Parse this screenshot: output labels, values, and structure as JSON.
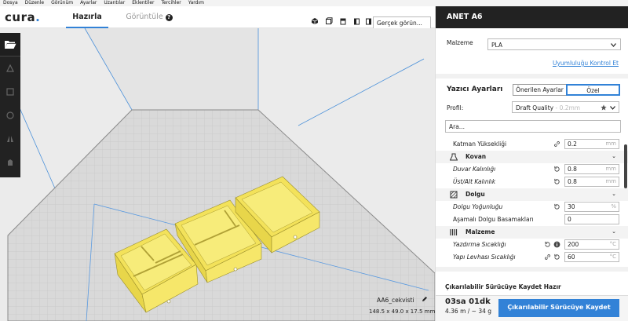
{
  "menu": [
    "Dosya",
    "Düzenle",
    "Görünüm",
    "Ayarlar",
    "Uzantılar",
    "Eklentiler",
    "Tercihler",
    "Yardım"
  ],
  "header": {
    "logo_text": "cura",
    "logo_dot": ".",
    "tab_prepare": "Hazırla",
    "tab_preview": "Görüntüle",
    "help_glyph": "?",
    "view_mode": "Gerçek görün..."
  },
  "viewport": {
    "object_name": "AA6_cekvisti",
    "object_dims": "148.5 x 49.0 x 17.5 mm"
  },
  "sidebar": {
    "printer": "ANET A6",
    "material_label": "Malzeme",
    "material_value": "PLA",
    "compat_link": "Uyumluluğu Kontrol Et",
    "settings_title": "Yazıcı Ayarları",
    "recommended": "Önerilen Ayarlar",
    "custom": "Özel",
    "profile_label": "Profil:",
    "profile_value": "Draft Quality",
    "profile_sub": "- 0.2mm",
    "search_placeholder": "Ara...",
    "layer_height_label": "Katman Yüksekliği",
    "layer_height_value": "0.2",
    "layer_height_unit": "mm",
    "shell_label": "Kovan",
    "wall_label": "Duvar Kalınlığı",
    "wall_value": "0.8",
    "wall_unit": "mm",
    "topbottom_label": "Üst/Alt Kalınlık",
    "topbottom_value": "0.8",
    "topbottom_unit": "mm",
    "infill_label": "Dolgu",
    "infill_density_label": "Dolgu Yoğunluğu",
    "infill_density_value": "30",
    "infill_density_unit": "%",
    "gradual_label": "Aşamalı Dolgu Basamakları",
    "gradual_value": "0",
    "material_cat_label": "Malzeme",
    "print_temp_label": "Yazdırma Sıcaklığı",
    "print_temp_value": "200",
    "print_temp_unit": "°C",
    "bed_temp_label": "Yapı Levhası Sıcaklığı",
    "bed_temp_value": "60",
    "bed_temp_unit": "°C",
    "save_title": "Çıkarılabilir Sürücüye Kaydet Hazır",
    "print_time": "03sa 01dk",
    "print_material": "4.36 m / ~ 34 g",
    "save_button": "Çıkarılabilir Sürücüye Kaydet"
  },
  "colors": {
    "accent": "#3282d7",
    "model": "#f5e65f",
    "dark": "#222222"
  }
}
